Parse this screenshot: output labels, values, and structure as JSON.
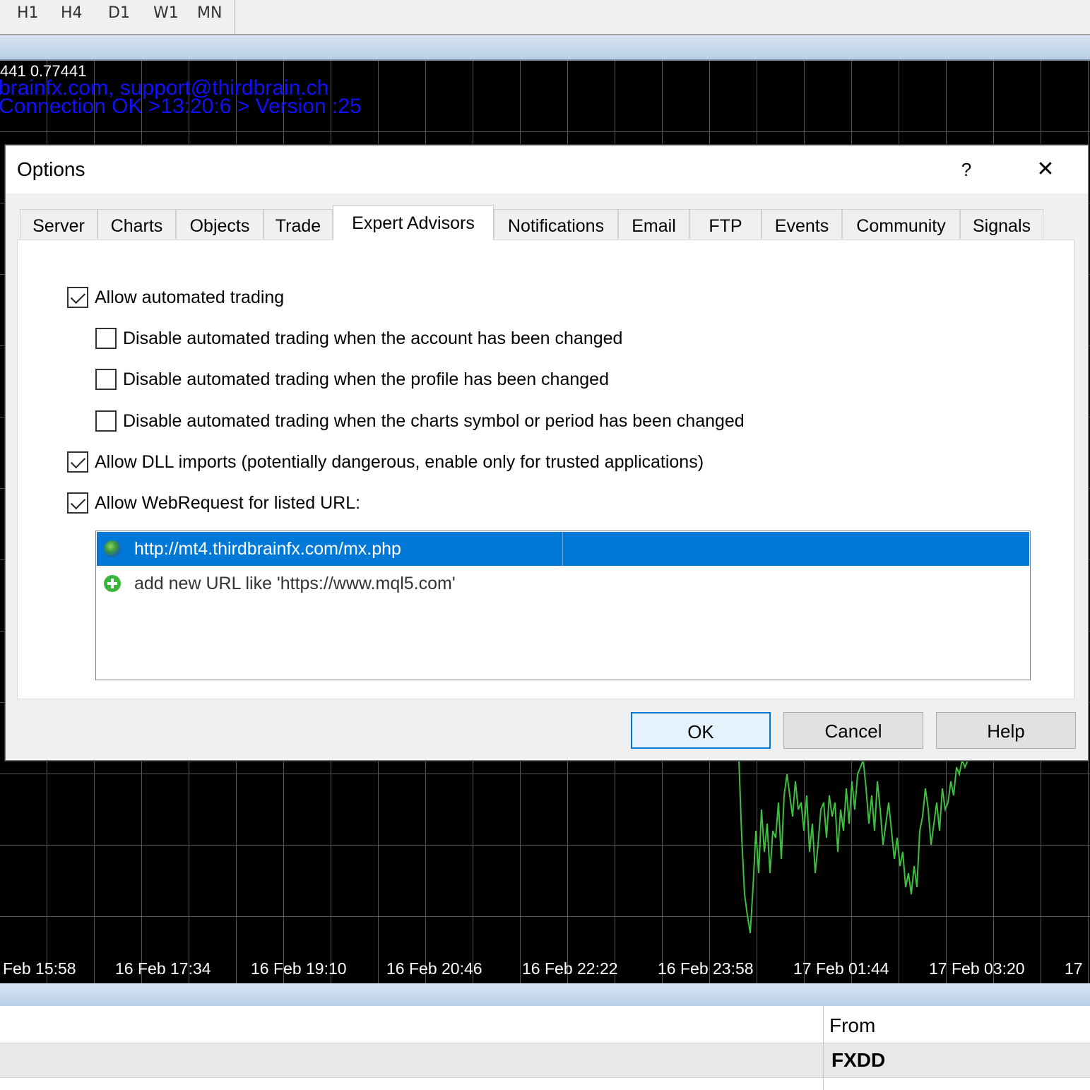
{
  "toolbar": {
    "timeframes": [
      "H1",
      "H4",
      "D1",
      "W1",
      "MN"
    ]
  },
  "chart": {
    "price_line": "441 0.77441",
    "contact_line": "brainfx.com, support@thirdbrain.ch",
    "status_line": "Connection OK >13:20:6 > Version :25",
    "time_labels": [
      "Feb 15:58",
      "16 Feb 17:34",
      "16 Feb 19:10",
      "16 Feb 20:46",
      "16 Feb 22:22",
      "16 Feb 23:58",
      "17 Feb 01:44",
      "17 Feb 03:20",
      "17"
    ],
    "price_series_color": "#3fbf3f"
  },
  "dialog": {
    "title": "Options",
    "help_glyph": "?",
    "close_glyph": "✕",
    "tabs": [
      "Server",
      "Charts",
      "Objects",
      "Trade",
      "Expert Advisors",
      "Notifications",
      "Email",
      "FTP",
      "Events",
      "Community",
      "Signals"
    ],
    "active_tab": "Expert Advisors",
    "options": [
      {
        "label": "Allow automated trading",
        "checked": true
      },
      {
        "label": "Disable automated trading when the account has been changed",
        "checked": false
      },
      {
        "label": "Disable automated trading when the profile has been changed",
        "checked": false
      },
      {
        "label": "Disable automated trading when the charts symbol or period has been changed",
        "checked": false
      },
      {
        "label": "Allow DLL imports (potentially dangerous, enable only for trusted applications)",
        "checked": true
      },
      {
        "label": "Allow WebRequest for listed URL:",
        "checked": true
      }
    ],
    "urls": [
      {
        "text": "http://mt4.thirdbrainfx.com/mx.php",
        "icon": "globe-icon",
        "selected": true
      },
      {
        "text": "add new URL like 'https://www.mql5.com'",
        "icon": "add-icon",
        "selected": false
      }
    ],
    "buttons": {
      "ok": "OK",
      "cancel": "Cancel",
      "help": "Help"
    },
    "accent_color": "#0078d7"
  },
  "bottom_panel": {
    "header": "From",
    "row_value": "FXDD"
  }
}
